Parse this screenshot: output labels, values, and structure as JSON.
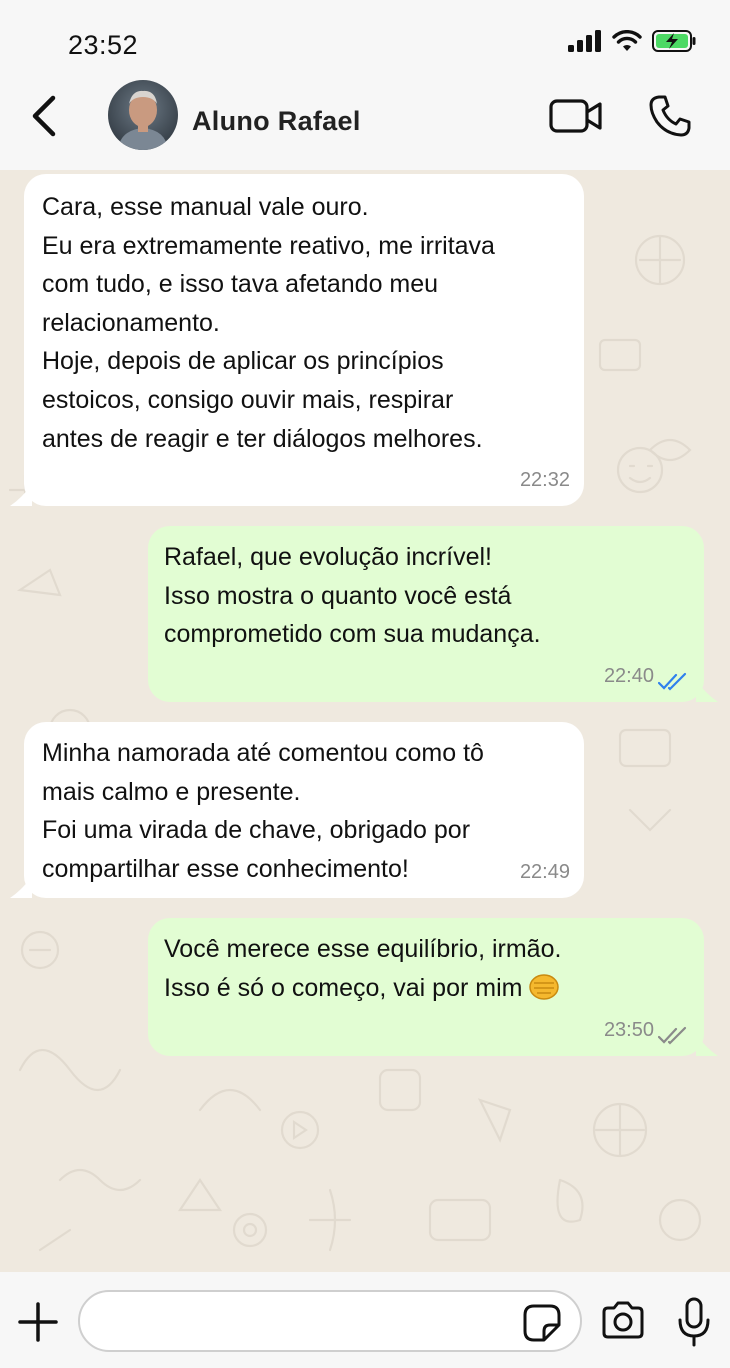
{
  "status": {
    "time": "23:52",
    "icons": [
      "signal-icon",
      "wifi-icon",
      "battery-charging-icon"
    ],
    "battery_color": "#4cd964"
  },
  "header": {
    "contact_name": "Aluno Rafael",
    "icons": [
      "back-chevron-icon",
      "video-call-icon",
      "phone-icon"
    ]
  },
  "messages": [
    {
      "direction": "in",
      "text": "Cara, esse manual vale ouro.\nEu era extremamente reativo, me irritava\ncom tudo, e isso tava afetando meu\nrelacionamento.\nHoje, depois de aplicar os princípios\nestoicos, consigo ouvir mais, respirar\nantes de reagir e ter diálogos melhores.",
      "time": "22:32"
    },
    {
      "direction": "out",
      "text": "Rafael, que evolução incrível!\nIsso mostra o quanto você está\ncomprometido com sua mudança.",
      "time": "22:40",
      "status": "read",
      "check_color": "#2f80ed"
    },
    {
      "direction": "in",
      "text": "Minha namorada até comentou como tô\nmais calmo e presente.\nFoi uma virada de chave, obrigado por\ncompartilhar esse conhecimento!",
      "time": "22:49"
    },
    {
      "direction": "out",
      "text": "Você merece esse equilíbrio, irmão.\nIsso é só o começo, vai por mim",
      "emoji": "oncoming-fist-emoji",
      "time": "23:50",
      "status": "delivered",
      "check_color": "#8a8a8a"
    }
  ],
  "composer": {
    "value": "",
    "placeholder": "",
    "icons": [
      "plus-icon",
      "sticker-icon",
      "camera-icon",
      "microphone-icon"
    ]
  },
  "colors": {
    "chat_background": "#efe9df",
    "incoming_bubble": "#ffffff",
    "outgoing_bubble": "#e2fdd3",
    "bars": "#f7f7f7"
  }
}
